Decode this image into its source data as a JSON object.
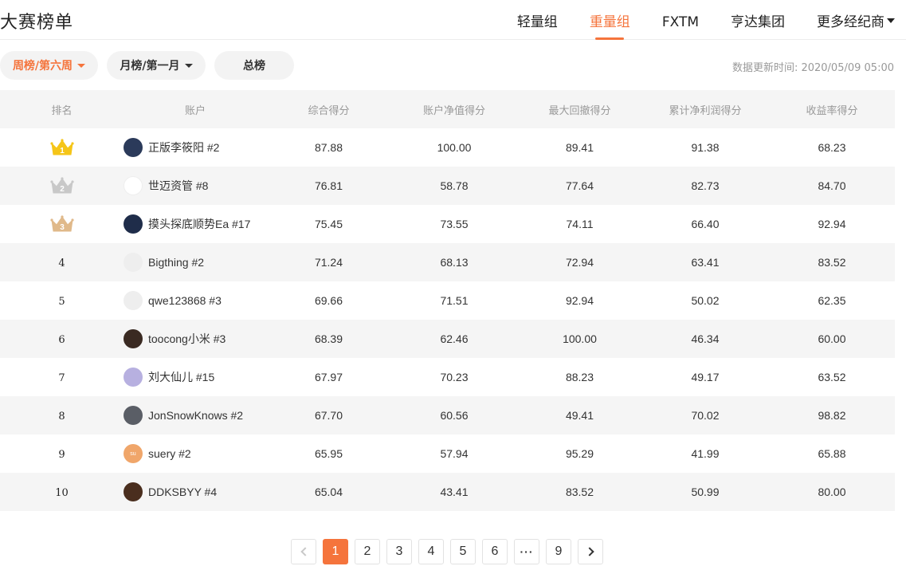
{
  "header": {
    "title": "大赛榜单",
    "tabs": [
      {
        "label": "轻量组",
        "active": false
      },
      {
        "label": "重量组",
        "active": true
      },
      {
        "label": "FXTM",
        "active": false
      },
      {
        "label": "亨达集团",
        "active": false
      },
      {
        "label": "更多经纪商",
        "active": false,
        "dropdown": true
      }
    ]
  },
  "filters": {
    "week": "周榜/第六周",
    "month": "月榜/第一月",
    "total": "总榜"
  },
  "update_time": "数据更新时间: 2020/05/09 05:00",
  "table": {
    "columns": [
      "排名",
      "账户",
      "综合得分",
      "账户净值得分",
      "最大回撤得分",
      "累计净利润得分",
      "收益率得分"
    ],
    "rows": [
      {
        "rank": "1",
        "name": "正版李筱阳 #2",
        "s1": "87.88",
        "s2": "100.00",
        "s3": "89.41",
        "s4": "91.38",
        "s5": "68.23"
      },
      {
        "rank": "2",
        "name": "世迈资管 #8",
        "s1": "76.81",
        "s2": "58.78",
        "s3": "77.64",
        "s4": "82.73",
        "s5": "84.70"
      },
      {
        "rank": "3",
        "name": "摸头探底顺势Ea #17",
        "s1": "75.45",
        "s2": "73.55",
        "s3": "74.11",
        "s4": "66.40",
        "s5": "92.94"
      },
      {
        "rank": "4",
        "name": "Bigthing #2",
        "s1": "71.24",
        "s2": "68.13",
        "s3": "72.94",
        "s4": "63.41",
        "s5": "83.52"
      },
      {
        "rank": "5",
        "name": "qwe123868 #3",
        "s1": "69.66",
        "s2": "71.51",
        "s3": "92.94",
        "s4": "50.02",
        "s5": "62.35"
      },
      {
        "rank": "6",
        "name": "toocong小米 #3",
        "s1": "68.39",
        "s2": "62.46",
        "s3": "100.00",
        "s4": "46.34",
        "s5": "60.00"
      },
      {
        "rank": "7",
        "name": "刘大仙儿 #15",
        "s1": "67.97",
        "s2": "70.23",
        "s3": "88.23",
        "s4": "49.17",
        "s5": "63.52"
      },
      {
        "rank": "8",
        "name": "JonSnowKnows #2",
        "s1": "67.70",
        "s2": "60.56",
        "s3": "49.41",
        "s4": "70.02",
        "s5": "98.82"
      },
      {
        "rank": "9",
        "name": "suery #2",
        "s1": "65.95",
        "s2": "57.94",
        "s3": "95.29",
        "s4": "41.99",
        "s5": "65.88"
      },
      {
        "rank": "10",
        "name": "DDKSBYY #4",
        "s1": "65.04",
        "s2": "43.41",
        "s3": "83.52",
        "s4": "50.99",
        "s5": "80.00"
      }
    ],
    "avatars": [
      {
        "bg": "#2b3a5a",
        "text": ""
      },
      {
        "bg": "#ffffff",
        "text": ""
      },
      {
        "bg": "#1f2d4a",
        "text": ""
      },
      {
        "bg": "#eeeeee",
        "text": ""
      },
      {
        "bg": "#eeeeee",
        "text": ""
      },
      {
        "bg": "#3a2a22",
        "text": ""
      },
      {
        "bg": "#b7b0e0",
        "text": ""
      },
      {
        "bg": "#5a5e66",
        "text": ""
      },
      {
        "bg": "#f0a66a",
        "text": "su"
      },
      {
        "bg": "#4a2e1e",
        "text": ""
      }
    ]
  },
  "pagination": {
    "prev": "prev-icon",
    "pages": [
      "1",
      "2",
      "3",
      "4",
      "5",
      "6"
    ],
    "ellipsis": "···",
    "last": "9",
    "current": "1",
    "next": "next-icon"
  },
  "colors": {
    "accent": "#f5743c",
    "gold": "#f5c518",
    "silver": "#c8c8c8",
    "bronze": "#e0b98a"
  }
}
